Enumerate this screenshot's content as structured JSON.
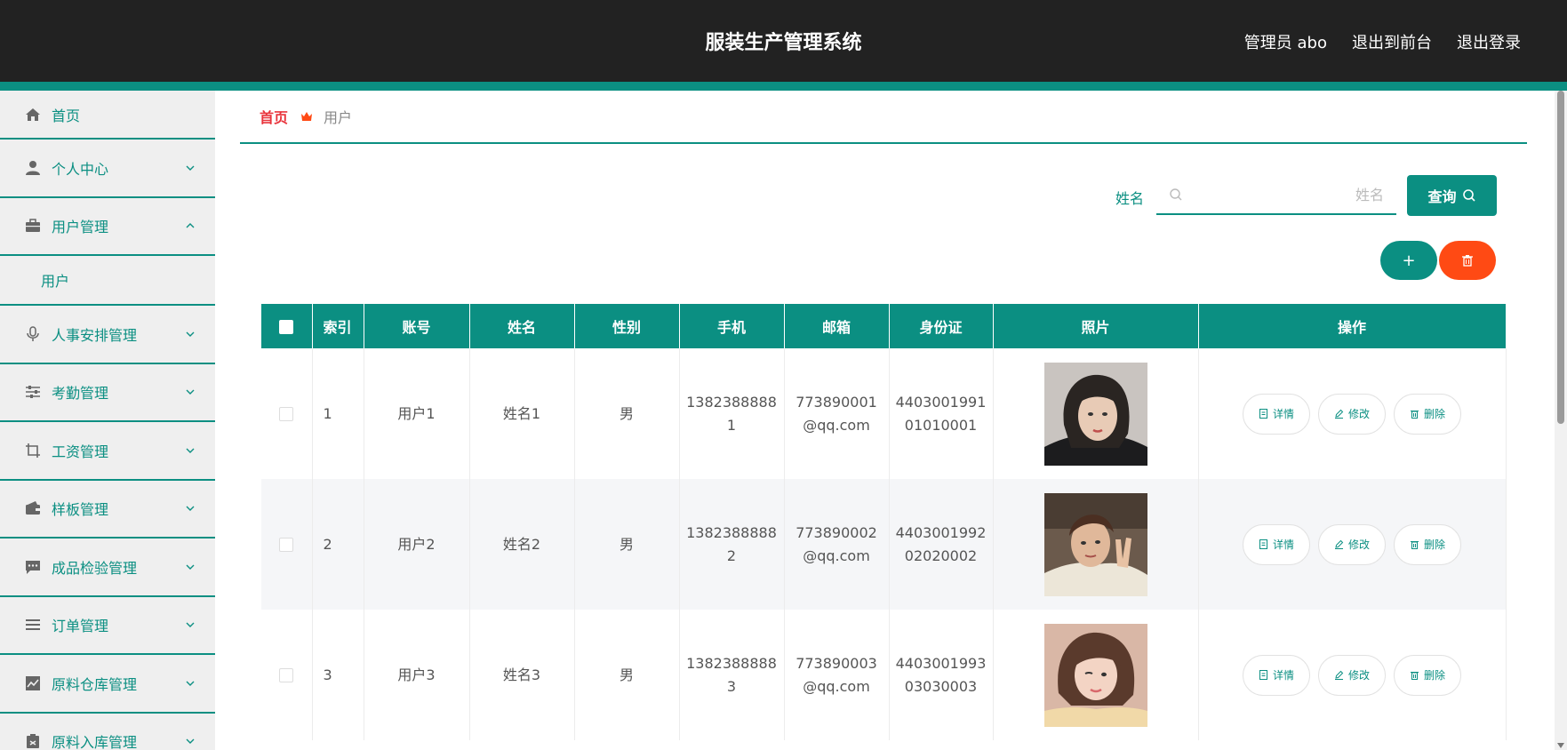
{
  "header": {
    "title": "服装生产管理系统",
    "admin_label": "管理员 abo",
    "to_front_label": "退出到前台",
    "logout_label": "退出登录"
  },
  "sidebar": {
    "items": [
      {
        "label": "首页",
        "icon": "home-icon"
      },
      {
        "label": "个人中心",
        "icon": "person-icon"
      },
      {
        "label": "用户管理",
        "icon": "briefcase-icon",
        "expanded": true,
        "sub": "用户"
      },
      {
        "label": "人事安排管理",
        "icon": "microphone-icon"
      },
      {
        "label": "考勤管理",
        "icon": "sliders-icon"
      },
      {
        "label": "工资管理",
        "icon": "crop-icon"
      },
      {
        "label": "样板管理",
        "icon": "wallet-icon"
      },
      {
        "label": "成品检验管理",
        "icon": "chat-icon"
      },
      {
        "label": "订单管理",
        "icon": "list-icon"
      },
      {
        "label": "原料仓库管理",
        "icon": "chart-icon"
      },
      {
        "label": "原料入库管理",
        "icon": "clipboard-icon"
      }
    ]
  },
  "breadcrumb": {
    "home": "首页",
    "current": "用户"
  },
  "search": {
    "label": "姓名",
    "placeholder": "姓名",
    "query_label": "查询",
    "add_label": "+"
  },
  "table": {
    "headers": [
      "索引",
      "账号",
      "姓名",
      "性别",
      "手机",
      "邮箱",
      "身份证",
      "照片",
      "操作"
    ],
    "rows": [
      {
        "index": "1",
        "account": "用户1",
        "name": "姓名1",
        "gender": "男",
        "phone_1": "1382388888",
        "phone_2": "1",
        "email_1": "773890001",
        "email_2": "@qq.com",
        "id_1": "4403001991",
        "id_2": "01010001"
      },
      {
        "index": "2",
        "account": "用户2",
        "name": "姓名2",
        "gender": "男",
        "phone_1": "1382388888",
        "phone_2": "2",
        "email_1": "773890002",
        "email_2": "@qq.com",
        "id_1": "4403001992",
        "id_2": "02020002"
      },
      {
        "index": "3",
        "account": "用户3",
        "name": "姓名3",
        "gender": "男",
        "phone_1": "1382388888",
        "phone_2": "3",
        "email_1": "773890003",
        "email_2": "@qq.com",
        "id_1": "4403001993",
        "id_2": "03030003"
      }
    ],
    "actions": {
      "detail": "详情",
      "edit": "修改",
      "delete": "删除"
    }
  },
  "colors": {
    "primary": "#0b8f82",
    "danger": "#ff4a14",
    "header_bg": "#222222",
    "breadcrumb_home": "#e9343c"
  }
}
